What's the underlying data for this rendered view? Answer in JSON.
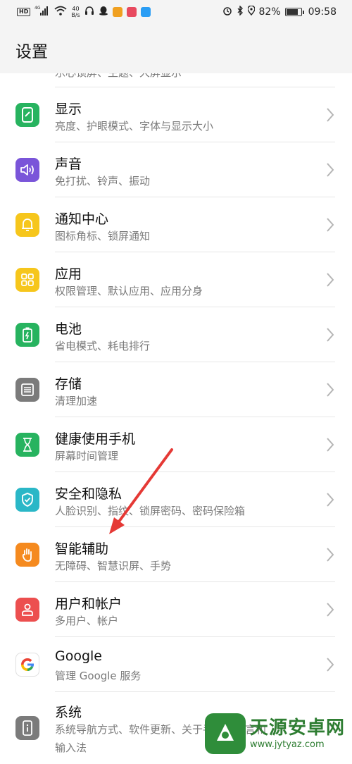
{
  "status_bar": {
    "hd": "HD",
    "network": "4G",
    "speed_value": "40",
    "speed_unit": "B/s",
    "battery": "82%",
    "time": "09:58"
  },
  "header": {
    "title": "设置"
  },
  "partial_item": {
    "subtitle": "乐心锁屏、主题、大屏显示"
  },
  "items": [
    {
      "title": "显示",
      "subtitle": "亮度、护眼模式、字体与显示大小",
      "icon": "display-icon",
      "color": "#27b35f"
    },
    {
      "title": "声音",
      "subtitle": "免打扰、铃声、振动",
      "icon": "sound-icon",
      "color": "#7a55d9"
    },
    {
      "title": "通知中心",
      "subtitle": "图标角标、锁屏通知",
      "icon": "bell-icon",
      "color": "#f6c61c"
    },
    {
      "title": "应用",
      "subtitle": "权限管理、默认应用、应用分身",
      "icon": "apps-icon",
      "color": "#f6c61c"
    },
    {
      "title": "电池",
      "subtitle": "省电模式、耗电排行",
      "icon": "battery-icon",
      "color": "#27b35f"
    },
    {
      "title": "存储",
      "subtitle": "清理加速",
      "icon": "storage-icon",
      "color": "#7b7b7b"
    },
    {
      "title": "健康使用手机",
      "subtitle": "屏幕时间管理",
      "icon": "hourglass-icon",
      "color": "#27b35f"
    },
    {
      "title": "安全和隐私",
      "subtitle": "人脸识别、指纹、锁屏密码、密码保险箱",
      "icon": "shield-icon",
      "color": "#2ab7c7"
    },
    {
      "title": "智能辅助",
      "subtitle": "无障碍、智慧识屏、手势",
      "icon": "hand-icon",
      "color": "#f58a1f"
    },
    {
      "title": "用户和帐户",
      "subtitle": "多用户、帐户",
      "icon": "user-icon",
      "color": "#ec4f4f"
    },
    {
      "title": "Google",
      "subtitle": "管理 Google 服务",
      "icon": "google-icon",
      "color": "#ffffff"
    },
    {
      "title": "系统",
      "subtitle": "系统导航方式、软件更新、关于手机、语言和",
      "subtitle2": "输入法",
      "icon": "system-icon",
      "color": "#7b7b7b"
    }
  ],
  "annotation": {
    "color": "#e53935"
  },
  "watermark": {
    "name": "天源安卓网",
    "url": "www.jytyaz.com"
  }
}
